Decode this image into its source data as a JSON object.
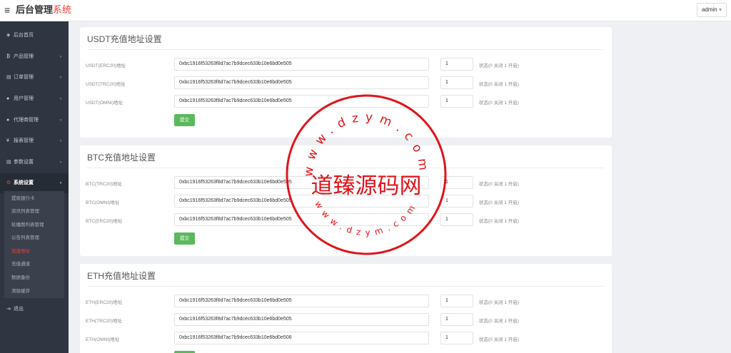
{
  "header": {
    "menu_icon": "≡",
    "brand_main": "后台管理",
    "brand_accent": "系统",
    "user_label": "admin",
    "user_caret": "▾"
  },
  "sidebar": {
    "items": [
      {
        "icon": "dashboard-icon",
        "glyph": "◈",
        "label": "后台首页",
        "has_arrow": false
      },
      {
        "icon": "bitcoin-icon",
        "glyph": "₿",
        "label": "产品管理",
        "has_arrow": true
      },
      {
        "icon": "copy-icon",
        "glyph": "▤",
        "label": "订单管理",
        "has_arrow": true
      },
      {
        "icon": "user-icon",
        "glyph": "●",
        "label": "用户管理",
        "has_arrow": true
      },
      {
        "icon": "people-icon",
        "glyph": "●",
        "label": "代理商管理",
        "has_arrow": true
      },
      {
        "icon": "yen-icon",
        "glyph": "¥",
        "label": "报表管理",
        "has_arrow": true
      },
      {
        "icon": "copy-icon",
        "glyph": "▤",
        "label": "参数设置",
        "has_arrow": true
      },
      {
        "icon": "cogs-icon",
        "glyph": "⚙",
        "label": "系统设置",
        "has_arrow": true
      },
      {
        "icon": "logout-icon",
        "glyph": "⇥",
        "label": "退出",
        "has_arrow": false
      }
    ],
    "subitems": [
      "提现银行卡",
      "资讯列表管理",
      "轮播图列表管理",
      "公告列表管理",
      "充值地址",
      "充值通道",
      "数据备份",
      "清除缓存"
    ],
    "arrow_glyph": "›"
  },
  "panels": [
    {
      "title": "USDT充值地址设置",
      "rows": [
        {
          "label": "USDT(ERC20)地址",
          "address": "0xbc1916f53263f8d7ac7b9dcec633b10e6bd0e505",
          "status": "1",
          "note": "状态(0 关闭 1 开启)"
        },
        {
          "label": "USDT(TRC20)地址",
          "address": "0xbc1916f53263f8d7ac7b9dcec633b10e6bd0e505",
          "status": "1",
          "note": "状态(0 关闭 1 开启)"
        },
        {
          "label": "USDT(OMNI)地址",
          "address": "0xbc1916f53263f8d7ac7b9dcec633b10e6bd0e505",
          "status": "1",
          "note": "状态(0 关闭 1 开启)"
        }
      ],
      "submit": "提交"
    },
    {
      "title": "BTC充值地址设置",
      "rows": [
        {
          "label": "BTC(TRC20)地址",
          "address": "0xbc1916f53263f8d7ac7b9dcec633b10e6bd0e505",
          "status": "1",
          "note": "状态(0 关闭 1 开启)"
        },
        {
          "label": "BTC(OMNI)地址",
          "address": "0xbc1916f53263f8d7ac7b9dcec633b10e6bd0e505",
          "status": "1",
          "note": "状态(0 关闭 1 开启)"
        },
        {
          "label": "BTC(ERC20)地址",
          "address": "0xbc1916f53263f8d7ac7b9dcec633b10e6bd0e505",
          "status": "1",
          "note": "状态(0 关闭 1 开启)"
        }
      ],
      "submit": "提交"
    },
    {
      "title": "ETH充值地址设置",
      "rows": [
        {
          "label": "ETH(ERC20)地址",
          "address": "0xbc1916f53263f8d7ac7b9dcec633b10e6bd0e505",
          "status": "1",
          "note": "状态(0 关闭 1 开启)"
        },
        {
          "label": "ETH(TRC20)地址",
          "address": "0xbc1916f53263f8d7ac7b9dcec633b10e6bd0e505",
          "status": "1",
          "note": "状态(0 关闭 1 开启)"
        },
        {
          "label": "ETH(OMNI)地址",
          "address": "0xbc1916f53263f8d7ac7b9dcec633b10e6bd0e506",
          "status": "1",
          "note": "状态(0 关闭 1 开启)"
        }
      ],
      "submit": "提交"
    }
  ],
  "watermark": {
    "center_text": "道臻源码网",
    "ring_text": "www.dzym.com",
    "color": "#e0141b"
  },
  "colors": {
    "sidebar_bg": "#2f3641",
    "accent_red": "#e8423a",
    "submit_green": "#5cb85c"
  }
}
